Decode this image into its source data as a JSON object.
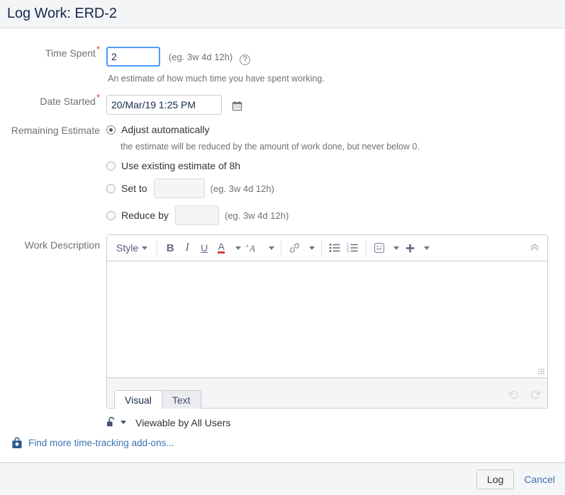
{
  "header": {
    "title": "Log Work: ERD-2"
  },
  "form": {
    "time_spent": {
      "label": "Time Spent",
      "required_mark": "*",
      "value": "2",
      "placeholder": "",
      "hint": "(eg. 3w 4d 12h)",
      "help_icon": "question-circle-icon",
      "description": "An estimate of how much time you have spent working."
    },
    "date_started": {
      "label": "Date Started",
      "required_mark": "*",
      "value": "20/Mar/19 1:25 PM",
      "placeholder": "",
      "calendar_icon": "calendar-icon"
    },
    "remaining_estimate": {
      "label": "Remaining Estimate",
      "options": [
        {
          "id": "auto",
          "label": "Adjust automatically",
          "selected": true,
          "description": "the estimate will be reduced by the amount of work done, but never below 0."
        },
        {
          "id": "existing",
          "label": "Use existing estimate of 8h",
          "selected": false
        },
        {
          "id": "setto",
          "label": "Set to",
          "selected": false,
          "value": "",
          "hint": "(eg. 3w 4d 12h)"
        },
        {
          "id": "reduceby",
          "label": "Reduce by",
          "selected": false,
          "value": "",
          "hint": "(eg. 3w 4d 12h)"
        }
      ]
    },
    "work_description": {
      "label": "Work Description",
      "value": "",
      "toolbar": {
        "style_label": "Style",
        "buttons": [
          {
            "name": "bold-icon",
            "glyph": "B"
          },
          {
            "name": "italic-icon",
            "glyph": "I"
          },
          {
            "name": "underline-icon",
            "glyph": "U"
          },
          {
            "name": "text-color-icon",
            "glyph": "A"
          },
          {
            "name": "text-effects-icon",
            "glyph": "ᵃA"
          },
          {
            "name": "link-icon",
            "glyph": "🔗"
          },
          {
            "name": "bullet-list-icon",
            "glyph": ""
          },
          {
            "name": "numbered-list-icon",
            "glyph": ""
          },
          {
            "name": "emoji-icon",
            "glyph": "☺"
          },
          {
            "name": "insert-more-icon",
            "glyph": "+"
          }
        ],
        "collapse_label": "collapse-toolbar-icon"
      },
      "tabs": [
        {
          "label": "Visual",
          "active": true
        },
        {
          "label": "Text",
          "active": false
        }
      ],
      "history": [
        {
          "name": "undo-icon",
          "enabled": false
        },
        {
          "name": "redo-icon",
          "enabled": false
        }
      ]
    },
    "visibility": {
      "icon": "unlocked-padlock-icon",
      "label": "Viewable by All Users"
    },
    "addons": {
      "icon": "marketplace-bag-icon",
      "link_text": "Find more time-tracking add-ons..."
    }
  },
  "footer": {
    "submit_label": "Log",
    "cancel_label": "Cancel"
  },
  "colors": {
    "header_bg": "#f4f5f7",
    "required_star": "#d04437",
    "link": "#3b73af",
    "focus_border": "#4c9aff",
    "label_text": "#707070"
  }
}
